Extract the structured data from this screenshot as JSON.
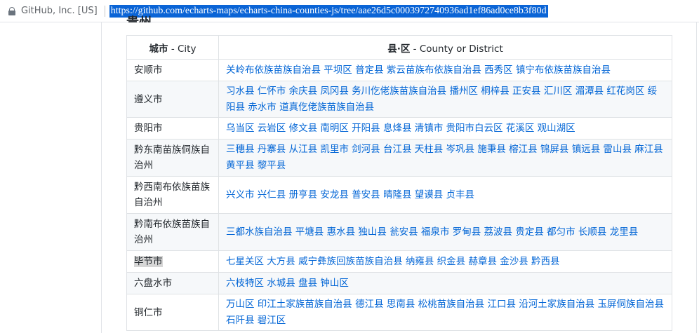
{
  "browser": {
    "site_identity": "GitHub, Inc. [US]",
    "url": "https://github.com/echarts-maps/echarts-china-counties-js/tree/aae26d5c0003972740936ad1ef86ad0ce8b3f80d"
  },
  "section": {
    "heading": "贵州"
  },
  "table": {
    "headers": {
      "city_cn": "城市",
      "city_en": " - City",
      "district_cn": "县·区",
      "district_en": " - County or District"
    },
    "rows": [
      {
        "city": "安顺市",
        "districts": "关岭布依族苗族自治县 平坝区 普定县 紫云苗族布依族自治县 西秀区 镇宁布依族苗族自治县"
      },
      {
        "city": "遵义市",
        "districts": "习水县 仁怀市 余庆县 凤冈县 务川仡佬族苗族自治县 播州区 桐梓县 正安县 汇川区 湄潭县 红花岗区 绥阳县 赤水市 道真仡佬族苗族自治县"
      },
      {
        "city": "贵阳市",
        "districts": "乌当区 云岩区 修文县 南明区 开阳县 息烽县 清镇市 贵阳市白云区 花溪区 观山湖区"
      },
      {
        "city": "黔东南苗族侗族自治州",
        "districts": "三穗县 丹寨县 从江县 凯里市 剑河县 台江县 天柱县 岑巩县 施秉县 榕江县 锦屏县 镇远县 雷山县 麻江县 黄平县 黎平县"
      },
      {
        "city": "黔西南布依族苗族自治州",
        "districts": "兴义市 兴仁县 册亨县 安龙县 普安县 晴隆县 望谟县 贞丰县"
      },
      {
        "city": "黔南布依族苗族自治州",
        "districts": "三都水族自治县 平塘县 惠水县 独山县 瓮安县 福泉市 罗甸县 荔波县 贵定县 都匀市 长顺县 龙里县"
      },
      {
        "city": "毕节市",
        "districts": "七星关区 大方县 威宁彝族回族苗族自治县 纳雍县 织金县 赫章县 金沙县 黔西县"
      },
      {
        "city": "六盘水市",
        "districts": "六枝特区 水城县 盘县 钟山区"
      },
      {
        "city": "铜仁市",
        "districts": "万山区 印江土家族苗族自治县 德江县 思南县 松桃苗族自治县 江口县 沿河土家族自治县 玉屏侗族自治县 石阡县 碧江区"
      }
    ]
  }
}
